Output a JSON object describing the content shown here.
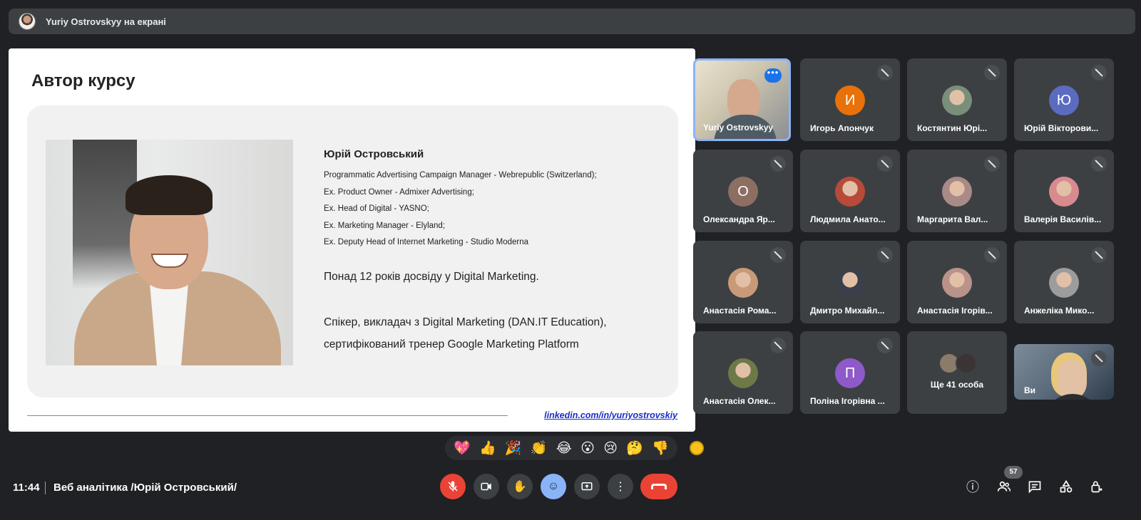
{
  "presenter_bar": {
    "title": "Yuriy Ostrovskyy на екрані"
  },
  "slide": {
    "heading": "Автор курсу",
    "name": "Юрій Островський",
    "roles": [
      "Programmatic Advertising Campaign Manager - Webrepublic (Switzerland);",
      "Ex. Product Owner - Admixer Advertising;",
      "Ex. Head of Digital - YASNO;",
      "Ex. Marketing Manager - Elyland;",
      "Ex. Deputy Head of Internet Marketing - Studio Moderna"
    ],
    "experience": "Понад 12 років досвіду у Digital Marketing.",
    "speaker_line1": "Спікер, викладач з Digital Marketing (DAN.IT Education),",
    "speaker_line2": "сертифікований тренер Google Marketing Platform",
    "link": "linkedin.com/in/yuriyostrovskiy"
  },
  "participants": [
    {
      "name": "Yuriy Ostrovskyy",
      "type": "video-active"
    },
    {
      "name": "Игорь Апончук",
      "initial": "И",
      "color": "#e8710a"
    },
    {
      "name": "Костянтин Юрі...",
      "type": "photo",
      "color": "#7a8f7a"
    },
    {
      "name": "Юрій Вікторови...",
      "initial": "Ю",
      "color": "#5b6bc0"
    },
    {
      "name": "Олександра Яр...",
      "initial": "О",
      "color": "#8d6e63"
    },
    {
      "name": "Людмила Анато...",
      "type": "photo",
      "color": "#b84a3a"
    },
    {
      "name": "Маргарита Вал...",
      "type": "photo",
      "color": "#a98a86"
    },
    {
      "name": "Валерія Василів...",
      "type": "photo",
      "color": "#d98a8f"
    },
    {
      "name": "Анастасія Рома...",
      "type": "photo",
      "color": "#c99a78"
    },
    {
      "name": "Дмитро Михайл...",
      "type": "photo",
      "color": "#3a3f4a"
    },
    {
      "name": "Анастасія Ігорів...",
      "type": "photo",
      "color": "#b9928a"
    },
    {
      "name": "Анжеліка Мико...",
      "type": "photo",
      "color": "#9c9c9c"
    },
    {
      "name": "Анастасія Олек...",
      "type": "photo",
      "color": "#6d7a48"
    },
    {
      "name": "Поліна Ігорівна ...",
      "initial": "П",
      "color": "#8e59c8"
    },
    {
      "name": "Ще 41 особа",
      "type": "more"
    },
    {
      "name": "Ви",
      "type": "self"
    }
  ],
  "reactions": [
    "💖",
    "👍",
    "🎉",
    "👏",
    "😂",
    "😮",
    "😢",
    "🤔",
    "👎"
  ],
  "bottom_bar": {
    "time": "11:44",
    "meeting_title": "Веб аналітика /Юрій Островський/",
    "participant_count": "57"
  },
  "colors": {
    "background": "#202124",
    "tile": "#3c4043",
    "end_call": "#ea4335",
    "active_border": "#8ab4f8"
  }
}
